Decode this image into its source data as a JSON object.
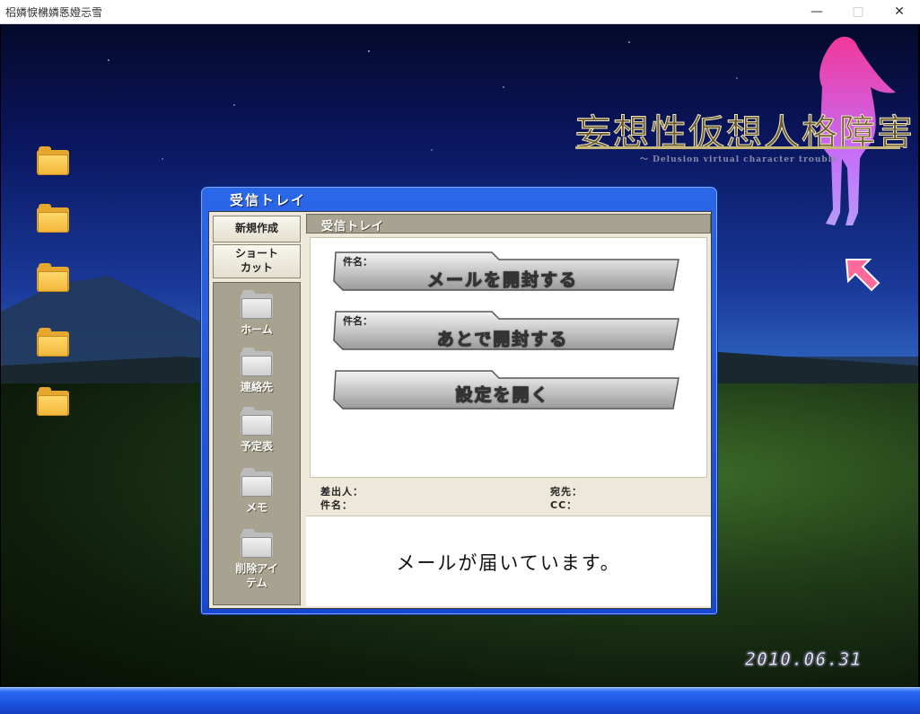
{
  "window": {
    "title": "梠嫾悷梻嫾悘嬁忈雪"
  },
  "desktop": {
    "logo_title": "妄想性仮想人格障害",
    "logo_subtitle": "～ Delusion virtual character trouble",
    "date": "2010.06.31"
  },
  "mailer": {
    "title": "受信トレイ",
    "sidebar": {
      "new_label": "新規作成",
      "shortcut_label": "ショート\nカット",
      "items": [
        {
          "label": "ホーム",
          "icon": "folder-icon"
        },
        {
          "label": "連絡先",
          "icon": "folder-icon"
        },
        {
          "label": "予定表",
          "icon": "folder-icon"
        },
        {
          "label": "メモ",
          "icon": "folder-icon"
        },
        {
          "label": "削除アイ\nテム",
          "icon": "folder-icon"
        }
      ]
    },
    "inbox_header": "受信トレイ",
    "actions": [
      {
        "subject_label": "件名：",
        "label": "メールを開封する"
      },
      {
        "subject_label": "件名：",
        "label": "あとで開封する"
      },
      {
        "subject_label": "",
        "label": "設定を開く"
      }
    ],
    "fields": {
      "from": "差出人：",
      "subject": "件名：",
      "to": "宛先：",
      "cc": "CC："
    },
    "preview_message": "メールが届いています。"
  },
  "colors": {
    "window_blue": "#1848d0",
    "panel_beige": "#ede8da",
    "sidebar_gray": "#a8a390",
    "folder_yellow": "#f3b63a"
  }
}
